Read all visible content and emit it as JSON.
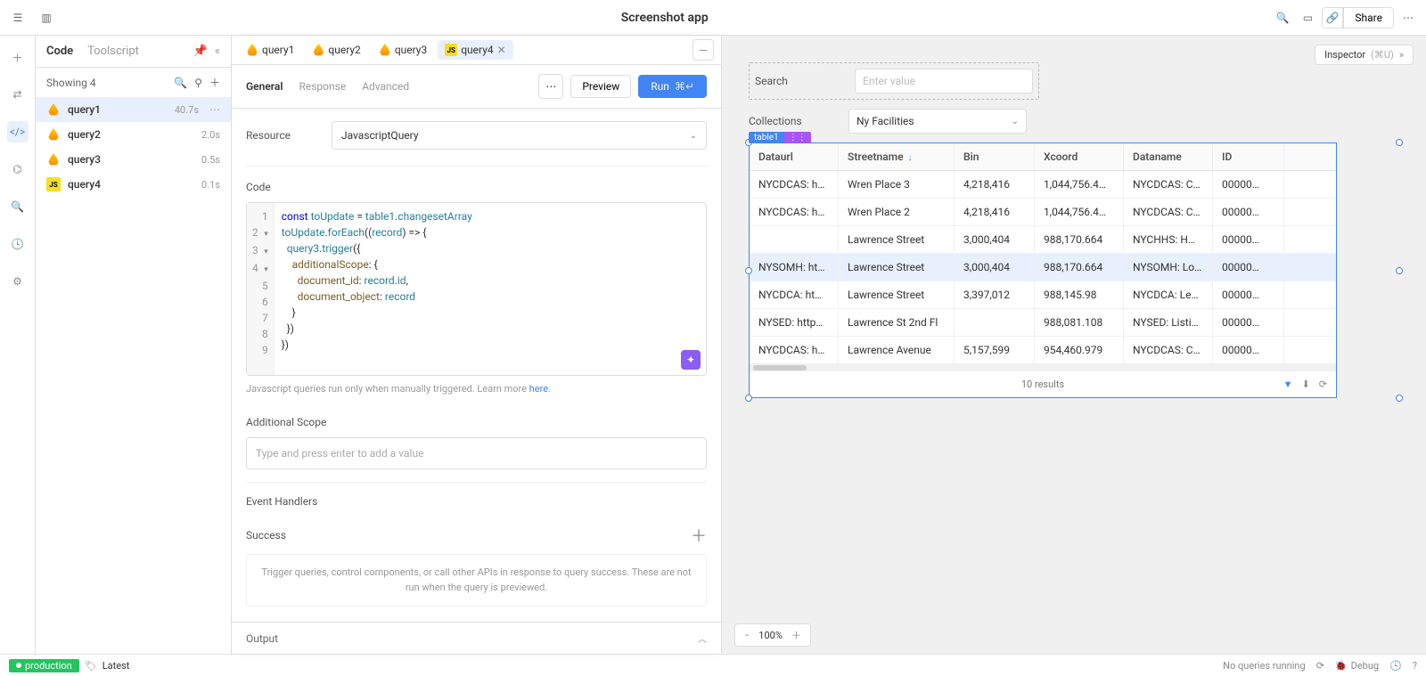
{
  "app_title": "Screenshot app",
  "topbar": {
    "share": "Share"
  },
  "left_panel": {
    "tabs": [
      "Code",
      "Toolscript"
    ],
    "showing": "Showing 4",
    "queries": [
      {
        "name": "query1",
        "time": "40.7s",
        "type": "fire"
      },
      {
        "name": "query2",
        "time": "2.0s",
        "type": "fire"
      },
      {
        "name": "query3",
        "time": "0.5s",
        "type": "fire"
      },
      {
        "name": "query4",
        "time": "0.1s",
        "type": "js"
      }
    ]
  },
  "editor": {
    "tabs": [
      {
        "name": "query1",
        "type": "fire"
      },
      {
        "name": "query2",
        "type": "fire"
      },
      {
        "name": "query3",
        "type": "fire"
      },
      {
        "name": "query4",
        "type": "js",
        "active": true
      }
    ],
    "subtabs": [
      "General",
      "Response",
      "Advanced"
    ],
    "preview": "Preview",
    "run": "Run",
    "run_shortcut": "⌘↵",
    "resource_label": "Resource",
    "resource_value": "JavascriptQuery",
    "code_label": "Code",
    "code_lines": [
      "const toUpdate = table1.changesetArray",
      "toUpdate.forEach((record) => {",
      "  query3.trigger({",
      "    additionalScope: {",
      "      document_id: record.id,",
      "      document_object: record",
      "    }",
      "  })",
      "})"
    ],
    "code_note_prefix": "Javascript queries run only when manually triggered. Learn more ",
    "code_note_link": "here",
    "code_note_suffix": ".",
    "additional_scope_label": "Additional Scope",
    "additional_scope_placeholder": "Type and press enter to add a value",
    "event_handlers_label": "Event Handlers",
    "success_label": "Success",
    "success_desc": "Trigger queries, control components, or call other APIs in response to query success. These are not run when the query is previewed.",
    "output_label": "Output"
  },
  "canvas": {
    "inspector": "Inspector",
    "inspector_shortcut": "(⌘U)",
    "search_label": "Search",
    "search_placeholder": "Enter value",
    "collections_label": "Collections",
    "collections_value": "Ny Facilities",
    "table_component_name": "table1",
    "columns": [
      "Dataurl",
      "Streetname",
      "Bin",
      "Xcoord",
      "Dataname",
      "ID"
    ],
    "sort_column": "Streetname",
    "rows": [
      [
        "NYCDCAS: h…",
        "Wren Place 3",
        "4,218,416",
        "1,044,756.4…",
        "NYCDCAS: C…",
        "00000…"
      ],
      [
        "NYCDCAS: h…",
        "Wren Place 2",
        "4,218,416",
        "1,044,756.4…",
        "NYCDCAS: C…",
        "00000…"
      ],
      [
        "",
        "Lawrence Street",
        "3,000,404",
        "988,170.664",
        "NYCHHS: H…",
        "00000…"
      ],
      [
        "NYSOMH: ht…",
        "Lawrence Street",
        "3,000,404",
        "988,170.664",
        "NYSOMH: Lo…",
        "00000…"
      ],
      [
        "NYCDCA: ht…",
        "Lawrence Street",
        "3,397,012",
        "988,145.98",
        "NYCDCA: Le…",
        "00000…"
      ],
      [
        "NYSED: http…",
        "Lawrence St 2nd Fl",
        "",
        "988,081.108",
        "NYSED: Listi…",
        "00000…"
      ],
      [
        "NYCDCAS: h…",
        "Lawrence Avenue",
        "5,157,599",
        "954,460.979",
        "NYCDCAS: C…",
        "00000…"
      ]
    ],
    "highlighted_row_index": 3,
    "footer_text": "10 results",
    "zoom": "100%"
  },
  "footer": {
    "env": "production",
    "version": "Latest",
    "queue": "No queries running",
    "debug": "Debug"
  }
}
